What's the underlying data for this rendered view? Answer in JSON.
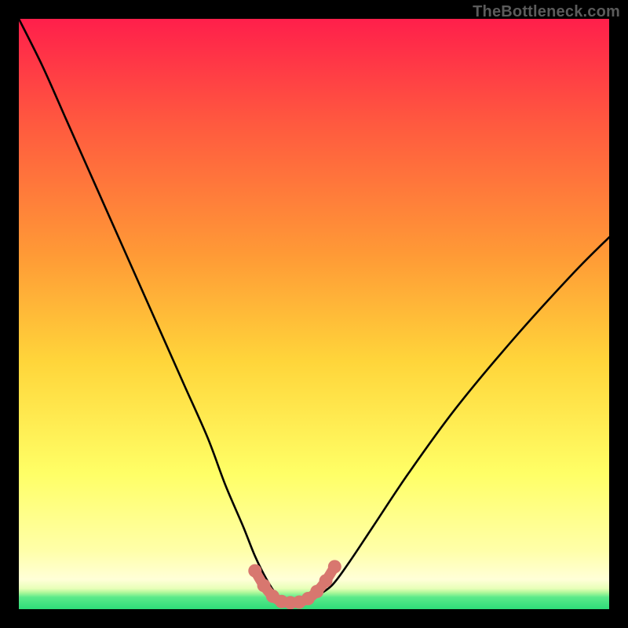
{
  "watermark": "TheBottleneck.com",
  "colors": {
    "frame": "#000000",
    "gradient_top": "#ff1f4b",
    "gradient_mid1": "#ff7a3a",
    "gradient_mid2": "#ffd53a",
    "gradient_mid3": "#ffff66",
    "gradient_low": "#ffffb0",
    "gradient_green": "#35e27a",
    "curve": "#000000",
    "marker": "#d8776f"
  },
  "chart_data": {
    "type": "line",
    "title": "",
    "xlabel": "",
    "ylabel": "",
    "xlim": [
      0,
      100
    ],
    "ylim": [
      0,
      100
    ],
    "series": [
      {
        "name": "bottleneck-curve",
        "x": [
          0,
          4,
          8,
          12,
          16,
          20,
          24,
          28,
          32,
          35,
          38,
          40,
          42,
          44,
          46,
          48,
          50,
          53,
          56,
          60,
          66,
          74,
          84,
          94,
          100
        ],
        "y": [
          100,
          92,
          83,
          74,
          65,
          56,
          47,
          38,
          29,
          21,
          14,
          9,
          5,
          2,
          1,
          1,
          2,
          4,
          8,
          14,
          23,
          34,
          46,
          57,
          63
        ]
      }
    ],
    "markers": {
      "name": "highlight-dots",
      "x": [
        40,
        41.5,
        43,
        44.5,
        46,
        47.5,
        49,
        50.5,
        52,
        53.5
      ],
      "y": [
        6.5,
        4.0,
        2.2,
        1.3,
        1.1,
        1.2,
        1.8,
        3.0,
        4.8,
        7.2
      ]
    },
    "bands": [
      {
        "name": "green-band",
        "y0": 0,
        "y1": 3,
        "color": "#35e27a"
      }
    ]
  }
}
